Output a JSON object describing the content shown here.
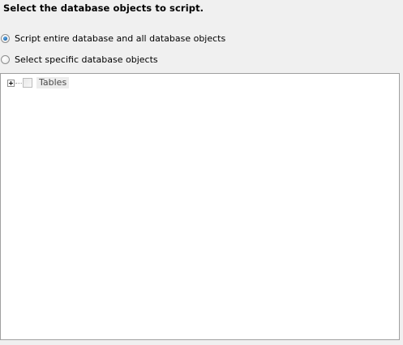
{
  "heading": "Select the database objects to script.",
  "options": {
    "entire": {
      "label": "Script entire database and all database objects",
      "selected": true
    },
    "specific": {
      "label": "Select specific database objects",
      "selected": false
    }
  },
  "tree": {
    "nodes": [
      {
        "label": "Tables",
        "expanded": false,
        "checked": false,
        "enabled": false
      }
    ]
  }
}
